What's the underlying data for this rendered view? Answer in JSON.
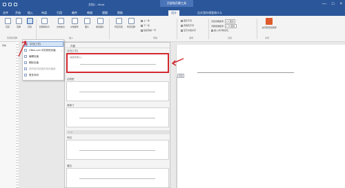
{
  "titlebar": {
    "doc_title": "文档1 - Word",
    "context_tab": "页眉和页脚工具",
    "window_controls": [
      "—",
      "□",
      "×"
    ]
  },
  "tabs": {
    "items": [
      "文件",
      "开始",
      "插入",
      "设计",
      "布局",
      "引用",
      "邮件",
      "审阅",
      "视图",
      "帮助"
    ],
    "active": "设计",
    "tell_me": "告诉我你想要做什么"
  },
  "ribbon": {
    "buttons": [
      "页眉",
      "页脚",
      "页码",
      "日期和时间",
      "文档信息",
      "文档部件",
      "图片",
      "联机图片",
      "转至页眉",
      "转至页脚"
    ],
    "nav_small": [
      "上一条",
      "下一条",
      "链接到前一节"
    ],
    "options": [
      "首页不同",
      "奇偶页不同",
      "显示文档文字"
    ],
    "position": [
      "页眉顶端距离:",
      "页脚底端距离:",
      "插入对齐制表位"
    ],
    "position_values": [
      "1.5 厘米",
      "1.75 厘米"
    ],
    "close_label": "关闭页眉和页脚",
    "groups": [
      "页眉和页脚",
      "插入",
      "导航",
      "选项",
      "位置",
      "关闭"
    ]
  },
  "nav": {
    "label": "导航"
  },
  "menu": {
    "items": [
      {
        "label": "空白(三栏)",
        "highlighted": true
      },
      {
        "label": "Office.com 中的其他页眉",
        "arrow": "›"
      },
      {
        "label": "编辑页眉"
      },
      {
        "label": "删除页眉"
      },
      {
        "label": "将所选内容保存到页眉库",
        "dim": true
      },
      {
        "label": "更多页码"
      }
    ]
  },
  "gallery": {
    "title": "内置",
    "cards": [
      {
        "label": "空白(三栏)",
        "mini": "[在此处键入]",
        "highlighted": true
      },
      {
        "label": "边线型"
      },
      {
        "label": "奥斯汀"
      },
      {
        "label": "怀旧"
      },
      {
        "label": "镶边"
      }
    ],
    "section": "1 / 2"
  },
  "document": {
    "header_tag": "页眉"
  }
}
